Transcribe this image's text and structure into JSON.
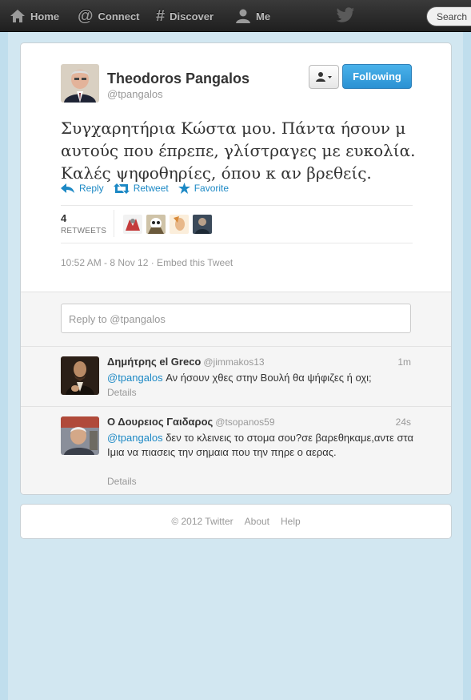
{
  "nav": {
    "home": "Home",
    "connect": "Connect",
    "discover": "Discover",
    "me": "Me",
    "search_placeholder": "Search"
  },
  "tweet": {
    "fullname": "Theodoros Pangalos",
    "handle": "@tpangalos",
    "following_label": "Following",
    "lines": [
      "Συγχαρητήρια Κώστα μου. Πάντα ήσουν μ",
      "αυτούς που έπρεπε, γλίστραγες με ευκολία.",
      "Καλές ψηφοθηρίες, όπου κ αν βρεθείς."
    ],
    "actions": {
      "reply": "Reply",
      "retweet": "Retweet",
      "favorite": "Favorite"
    },
    "retweet_count": "4",
    "retweets_label": "RETWEETS",
    "timestamp": "10:52 AM - 8 Nov 12 · Embed this Tweet"
  },
  "reply_box": {
    "placeholder": "Reply to @tpangalos"
  },
  "replies": [
    {
      "name": "Δημήτρης el Greco",
      "handle": "@jimmakos13",
      "time": "1m",
      "mention": "@tpangalos",
      "text": " Αν ήσουν χθες στην Βουλή θα ψήφιζες ή οχι;",
      "details": "Details"
    },
    {
      "name": "Ο Δουρειος Γαιδαρος",
      "handle": "@tsopanos59",
      "time": "24s",
      "mention": "@tpangalos",
      "text": " δεν το κλεινεις το στομα σου?σε βαρεθηκαμε,αντε στα Ιμια να πιασεις την σημαια που την πηρε ο αερας.",
      "details": "Details"
    }
  ],
  "footer": {
    "copyright": "© 2012 Twitter",
    "about": "About",
    "help": "Help"
  },
  "colors": {
    "accent": "#1d89c5",
    "background": "#c0deed",
    "follow_button": "#2a91d3"
  }
}
